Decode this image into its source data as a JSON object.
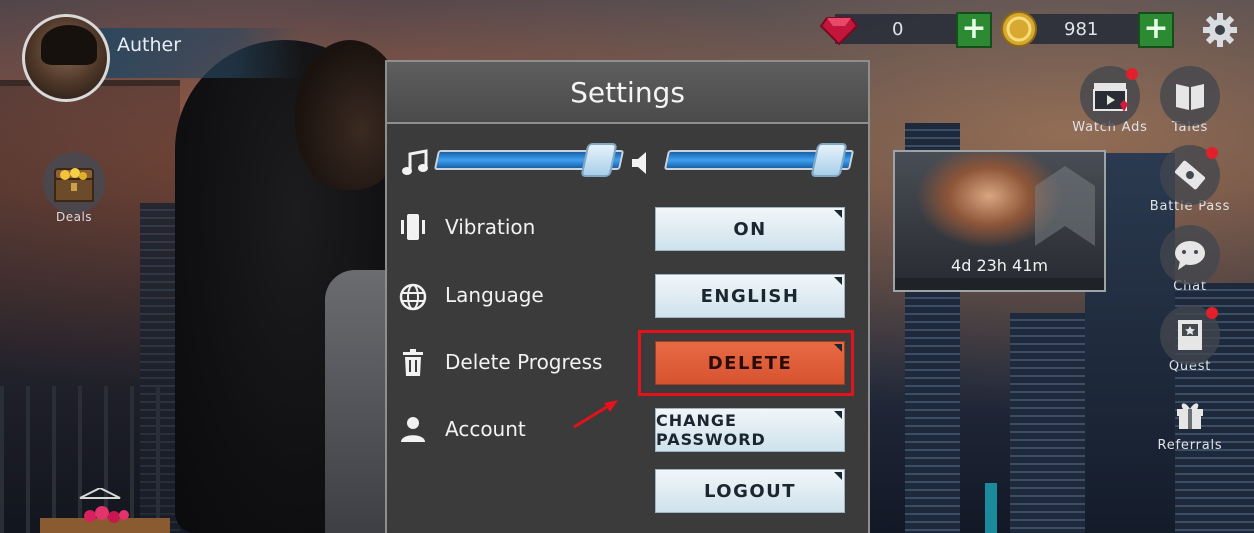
{
  "profile": {
    "name": "Auther"
  },
  "deals": {
    "label": "Deals"
  },
  "currency": {
    "gems": "0",
    "coins": "981"
  },
  "settings": {
    "title": "Settings",
    "music_volume": 0.95,
    "sfx_volume": 0.95,
    "rows": {
      "vibration": {
        "label": "Vibration",
        "button": "ON"
      },
      "language": {
        "label": "Language",
        "button": "ENGLISH"
      },
      "delete": {
        "label": "Delete Progress",
        "button": "DELETE"
      },
      "account": {
        "label": "Account",
        "change_password": "CHANGE PASSWORD",
        "logout": "LOGOUT"
      }
    }
  },
  "event": {
    "timer": "4d 23h 41m"
  },
  "right_menu": {
    "watch_ads": "Watch Ads",
    "tales": "Tales",
    "battle_pass": "Battle Pass",
    "chat": "Chat",
    "quest": "Quest",
    "referrals": "Referrals"
  },
  "colors": {
    "accent_blue": "#3ea0f0",
    "danger": "#e86a45",
    "highlight": "#e3121c",
    "plus_green": "#2c8a33"
  }
}
